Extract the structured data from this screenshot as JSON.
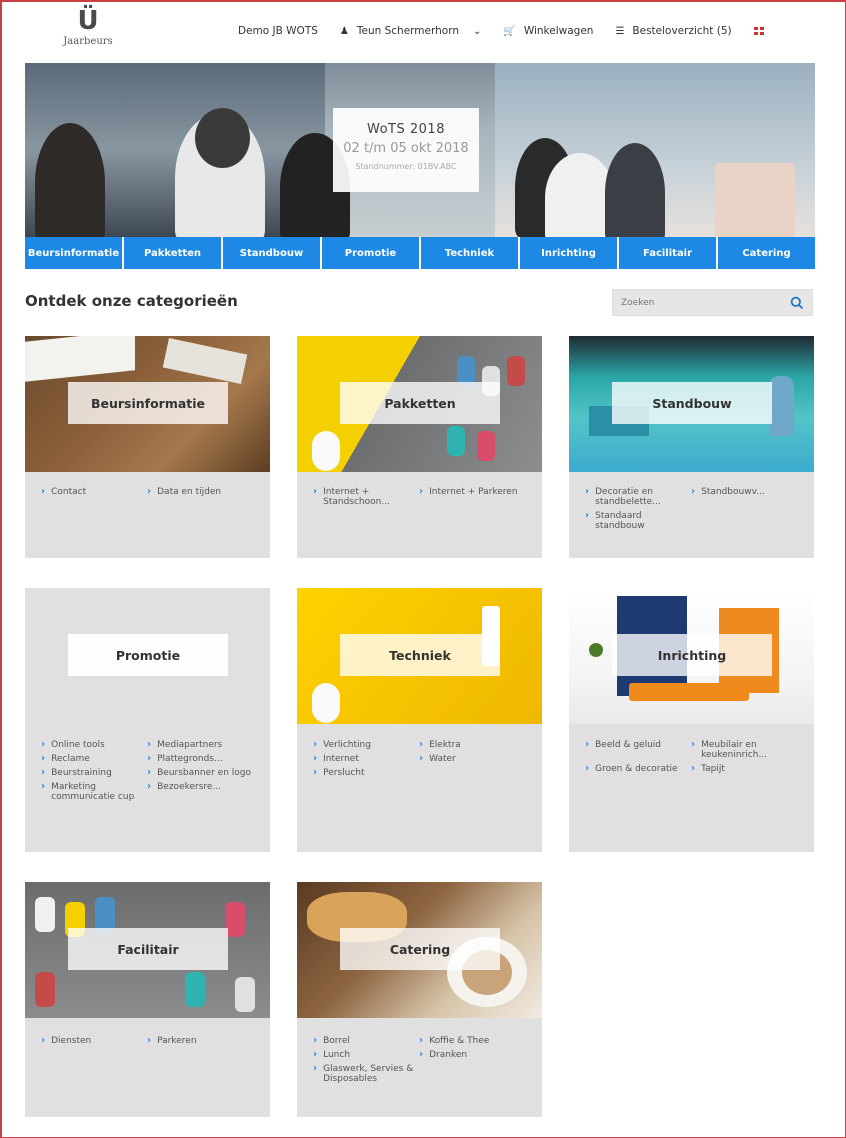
{
  "header": {
    "logo_text": "Jaarbeurs",
    "nav": {
      "demo": "Demo JB WOTS",
      "user": "Teun Schermerhorn",
      "cart": "Winkelwagen",
      "orders": "Besteloverzicht (5)"
    }
  },
  "hero": {
    "title": "WoTS 2018",
    "date": "02 t/m 05 okt 2018",
    "stand": "Standnummer: 01BV.ABC"
  },
  "category_tabs": [
    "Beursinformatie",
    "Pakketten",
    "Standbouw",
    "Promotie",
    "Techniek",
    "Inrichting",
    "Facilitair",
    "Catering"
  ],
  "section": {
    "title": "Ontdek onze categorieën",
    "search_placeholder": "Zoeken"
  },
  "cards": [
    {
      "title": "Beursinformatie",
      "links": [
        "Contact",
        "Data en tijden"
      ]
    },
    {
      "title": "Pakketten",
      "links": [
        "Internet + Standschoon...",
        "Internet + Parkeren"
      ]
    },
    {
      "title": "Standbouw",
      "links": [
        "Decoratie en standbelette...",
        "Standbouwv...",
        "Standaard standbouw"
      ]
    },
    {
      "title": "Promotie",
      "links": [
        "Online tools",
        "Mediapartners",
        "Reclame",
        "Plattegronds...",
        "Beurstraining",
        "Beursbanner en logo",
        "Marketing communicatie cup",
        "Bezoekersre..."
      ]
    },
    {
      "title": "Techniek",
      "links": [
        "Verlichting",
        "Elektra",
        "Internet",
        "Water",
        "Perslucht"
      ]
    },
    {
      "title": "Inrichting",
      "links": [
        "Beeld & geluid",
        "Meubilair en keukeninrich...",
        "Groen & decoratie",
        "Tapijt"
      ]
    },
    {
      "title": "Facilitair",
      "links": [
        "Diensten",
        "Parkeren"
      ]
    },
    {
      "title": "Catering",
      "links": [
        "Borrel",
        "Koffie & Thee",
        "Lunch",
        "Dranken",
        "Glaswerk, Servies & Disposables"
      ]
    }
  ]
}
